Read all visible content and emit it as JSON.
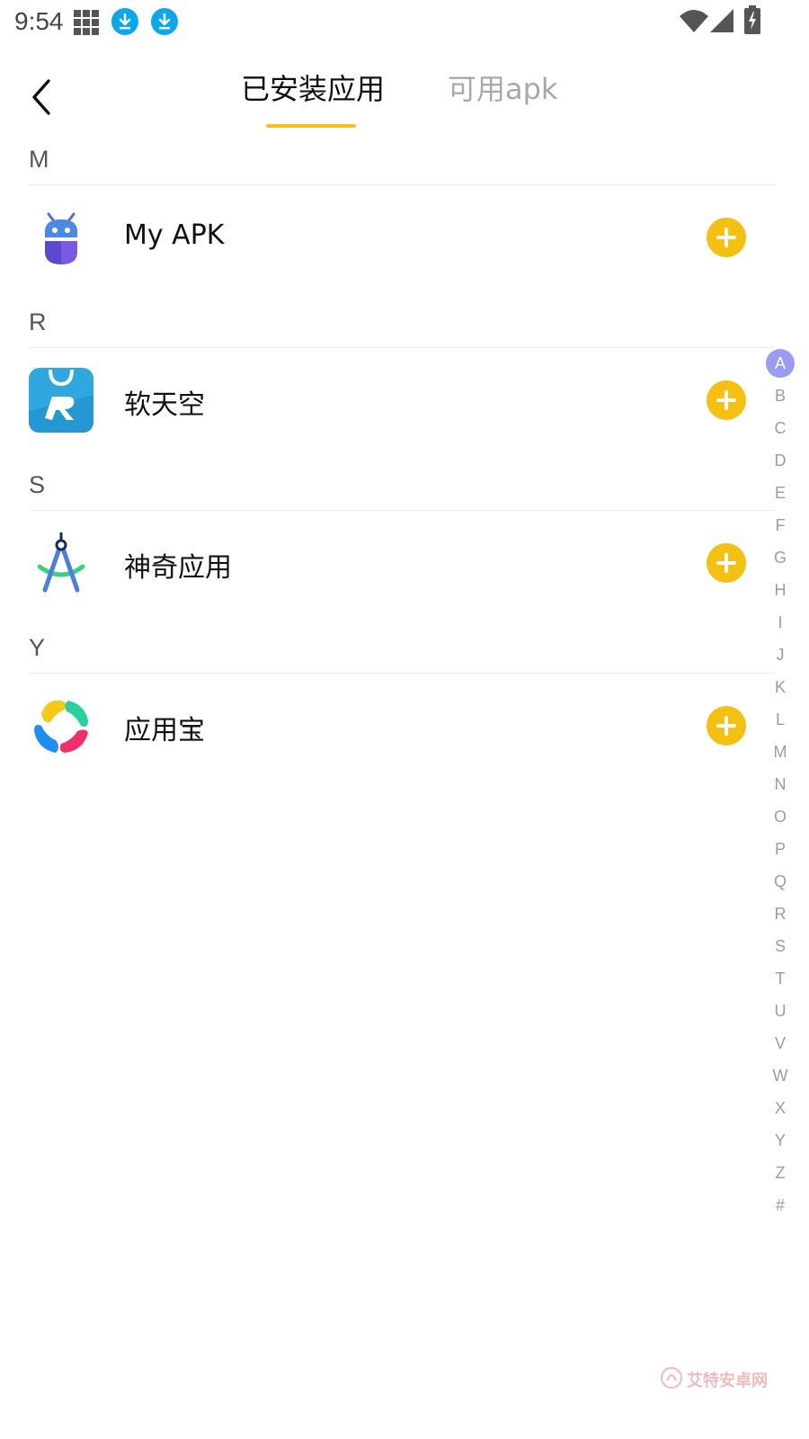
{
  "status_bar": {
    "time": "9:54",
    "icons": [
      "grid-icon",
      "download-icon",
      "download-icon",
      "wifi-icon",
      "signal-icon",
      "battery-charging-icon"
    ],
    "download_color": "#0aa8e8"
  },
  "header": {
    "back_icon": "chevron-left-icon",
    "tabs": [
      {
        "label": "已安装应用",
        "active": true
      },
      {
        "label": "可用apk",
        "active": false
      }
    ],
    "accent": "#f4c012"
  },
  "sections": [
    {
      "letter": "M",
      "apps": [
        {
          "name": "My APK",
          "icon": "my-apk-robot-icon"
        }
      ]
    },
    {
      "letter": "R",
      "apps": [
        {
          "name": "软天空",
          "icon": "ruantiankong-icon"
        }
      ]
    },
    {
      "letter": "S",
      "apps": [
        {
          "name": "神奇应用",
          "icon": "android-studio-compass-icon"
        }
      ]
    },
    {
      "letter": "Y",
      "apps": [
        {
          "name": "应用宝",
          "icon": "yingyongbao-icon"
        }
      ]
    }
  ],
  "alphabet_index": {
    "letters": [
      "A",
      "B",
      "C",
      "D",
      "E",
      "F",
      "G",
      "H",
      "I",
      "J",
      "K",
      "L",
      "M",
      "N",
      "O",
      "P",
      "Q",
      "R",
      "S",
      "T",
      "U",
      "V",
      "W",
      "X",
      "Y",
      "Z",
      "#"
    ],
    "active": "A",
    "active_color": "#9a9cf4"
  },
  "watermark": {
    "text": "艾特安卓网"
  }
}
